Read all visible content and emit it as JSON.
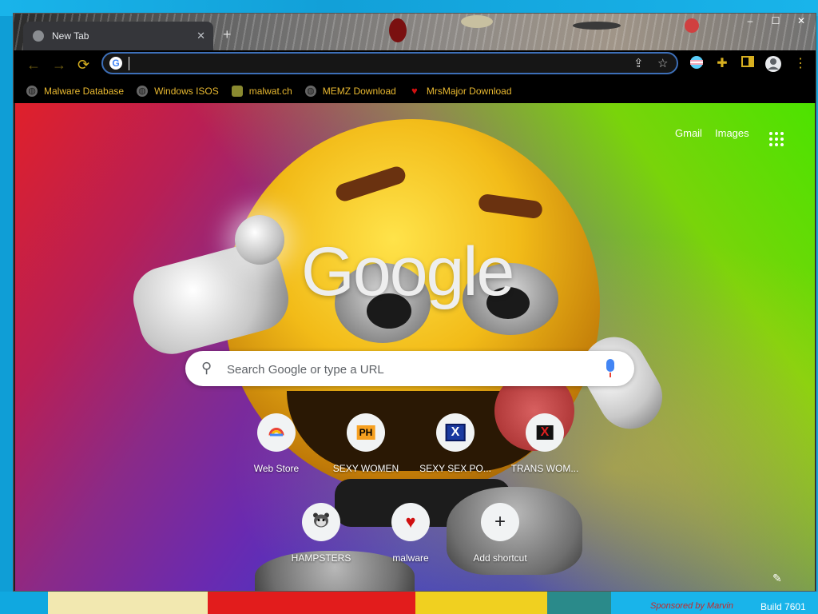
{
  "tab": {
    "title": "New Tab",
    "close": "✕",
    "new": "+"
  },
  "window_controls": {
    "minimize": "–",
    "maximize": "☐",
    "close": "✕"
  },
  "nav": {
    "back": "←",
    "forward": "→",
    "reload": "⟳"
  },
  "omnibox": {
    "value": "",
    "g_icon": "G"
  },
  "toolbar_icons": [
    "share-icon",
    "star-icon",
    "trans-flag-icon",
    "puzzle-icon",
    "sidebar-icon",
    "profile-icon",
    "menu-icon"
  ],
  "bookmarks": [
    {
      "label": "Malware Database",
      "icon": "globe-icon"
    },
    {
      "label": "Windows ISOS",
      "icon": "globe-icon"
    },
    {
      "label": "malwat.ch",
      "icon": "malwatch-icon"
    },
    {
      "label": "MEMZ Download",
      "icon": "globe-icon"
    },
    {
      "label": "MrsMajor Download",
      "icon": "heart-icon"
    }
  ],
  "header_links": {
    "gmail": "Gmail",
    "images": "Images"
  },
  "logo": "Google",
  "search": {
    "placeholder": "Search Google or type a URL"
  },
  "shortcuts": [
    {
      "label": "Web Store",
      "icon": "web-store-icon"
    },
    {
      "label": "SEXY WOMEN",
      "icon": "ph-icon",
      "icon_text": "PH"
    },
    {
      "label": "SEXY SEX PO...",
      "icon": "x-blue-icon",
      "icon_text": "X"
    },
    {
      "label": "TRANS WOM...",
      "icon": "x-red-icon",
      "icon_text": "X"
    },
    {
      "label": "HAMPSTERS",
      "icon": "hamster-icon"
    },
    {
      "label": "malware",
      "icon": "heart-icon"
    },
    {
      "label": "Add shortcut",
      "icon": "plus-icon",
      "icon_text": "+"
    }
  ],
  "desktop": {
    "build": "Build 7601",
    "sponsor": "Sponsored by Marvin"
  },
  "colors": {
    "accent_bookmark": "#e8b830",
    "omnibox_border": "#3d6fb8"
  }
}
